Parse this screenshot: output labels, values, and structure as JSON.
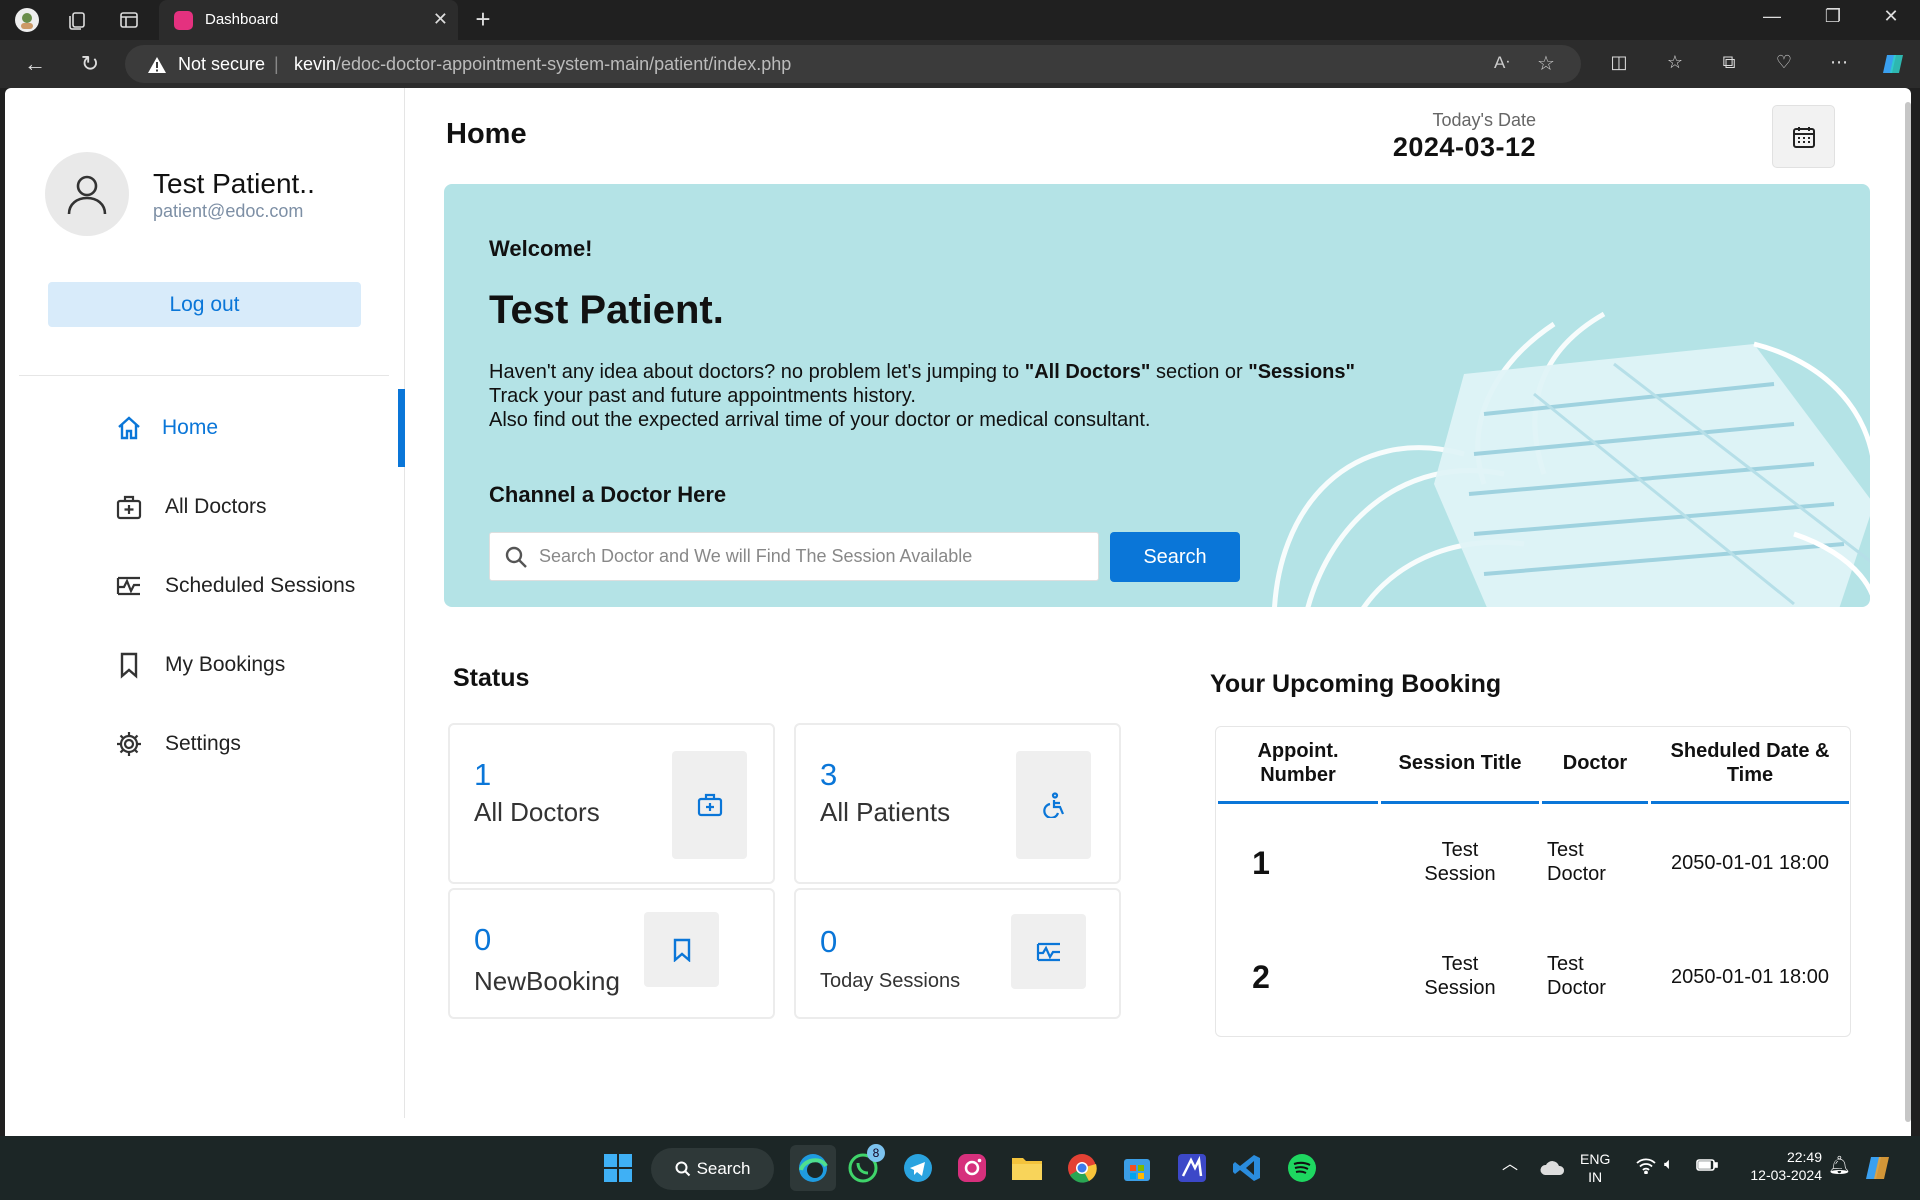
{
  "browser": {
    "tab_title": "Dashboard",
    "not_secure": "Not secure",
    "url_host": "kevin",
    "url_path": "/edoc-doctor-appointment-system-main/patient/index.php"
  },
  "sidebar": {
    "user_name": "Test Patient..",
    "user_email": "patient@edoc.com",
    "logout_label": "Log out",
    "items": [
      {
        "label": "Home",
        "icon": "home-icon",
        "active": true
      },
      {
        "label": "All Doctors",
        "icon": "medical-bag-icon",
        "active": false
      },
      {
        "label": "Scheduled Sessions",
        "icon": "schedule-icon",
        "active": false
      },
      {
        "label": "My Bookings",
        "icon": "bookmark-icon",
        "active": false
      },
      {
        "label": "Settings",
        "icon": "gear-icon",
        "active": false
      }
    ]
  },
  "header": {
    "title": "Home",
    "date_label": "Today's Date",
    "date_value": "2024-03-12"
  },
  "banner": {
    "welcome": "Welcome!",
    "name": "Test Patient.",
    "line1_pre": "Haven't any idea about doctors? no problem let's jumping to ",
    "line1_b1": "\"All Doctors\"",
    "line1_mid": " section or ",
    "line1_b2": "\"Sessions\"",
    "line2": "Track your past and future appointments history.",
    "line3": "Also find out the expected arrival time of your doctor or medical consultant.",
    "channel_title": "Channel a Doctor Here",
    "search_placeholder": "Search Doctor and We will Find The Session Available",
    "search_button": "Search"
  },
  "status": {
    "title": "Status",
    "cards": [
      {
        "value": "1",
        "label": "All Doctors",
        "icon": "medical-bag-icon"
      },
      {
        "value": "3",
        "label": "All Patients",
        "icon": "accessible-icon"
      },
      {
        "value": "0",
        "label": "NewBooking",
        "icon": "bookmark-icon"
      },
      {
        "value": "0",
        "label": "Today Sessions",
        "icon": "schedule-icon"
      }
    ]
  },
  "bookings": {
    "title": "Your Upcoming Booking",
    "headers": [
      "Appoint.\nNumber",
      "Session Title",
      "Doctor",
      "Sheduled Date &\nTime"
    ],
    "rows": [
      {
        "number": "1",
        "session": "Test\nSession",
        "doctor": "Test\nDoctor",
        "datetime": "2050-01-01 18:00"
      },
      {
        "number": "2",
        "session": "Test\nSession",
        "doctor": "Test\nDoctor",
        "datetime": "2050-01-01 18:00"
      }
    ]
  },
  "taskbar": {
    "search_label": "Search",
    "whatsapp_badge": "8",
    "lang_line1": "ENG",
    "lang_line2": "IN",
    "time": "22:49",
    "date": "12-03-2024"
  },
  "colors": {
    "accent": "#0a76d8",
    "banner_bg": "#b4e3e6",
    "logout_bg": "#d8ebfa"
  }
}
